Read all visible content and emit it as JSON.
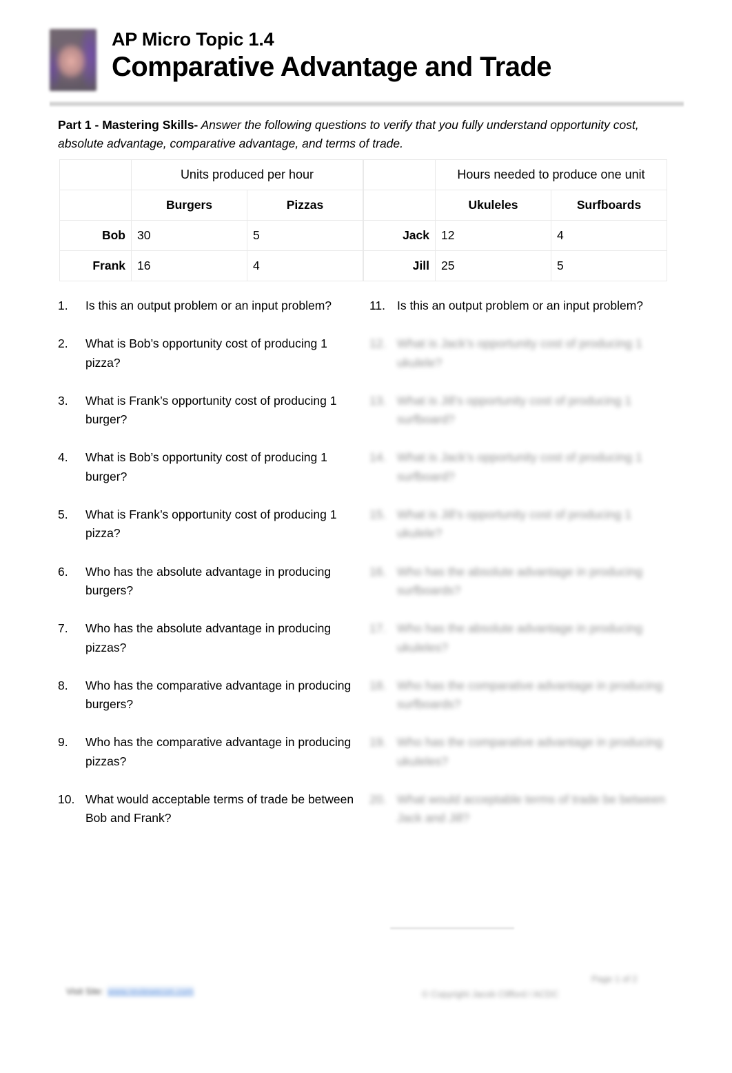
{
  "header": {
    "logo_alt": "course-logo",
    "subtitle": "AP Micro Topic 1.4",
    "title": "Comparative Advantage and Trade"
  },
  "instruction": {
    "label": "Part 1 - Mastering Skills-",
    "text": " Answer the following questions to verify that you fully understand opportunity cost, absolute advantage, comparative advantage, and terms of trade."
  },
  "table_left": {
    "span_header": "Units produced per hour",
    "columns": [
      "Burgers",
      "Pizzas"
    ],
    "rows": [
      {
        "name": "Bob",
        "values": [
          "30",
          "5"
        ]
      },
      {
        "name": "Frank",
        "values": [
          "16",
          "4"
        ]
      }
    ]
  },
  "table_right": {
    "span_header": "Hours needed to produce one unit",
    "columns": [
      "Ukuleles",
      "Surfboards"
    ],
    "rows": [
      {
        "name": "Jack",
        "values": [
          "12",
          "4"
        ]
      },
      {
        "name": "Jill",
        "values": [
          "25",
          "5"
        ]
      }
    ]
  },
  "questions_left": [
    {
      "num": "1.",
      "text": "Is this an output problem or an input problem?",
      "legible": true
    },
    {
      "num": "2.",
      "text": "What is Bob’s opportunity cost of producing 1 pizza?",
      "legible": true
    },
    {
      "num": "3.",
      "text": "What is Frank’s opportunity cost of producing 1 burger?",
      "legible": true
    },
    {
      "num": "4.",
      "text": "What is Bob’s opportunity cost of producing 1 burger?",
      "legible": true
    },
    {
      "num": "5.",
      "text": "What is Frank’s opportunity cost of producing 1 pizza?",
      "legible": true
    },
    {
      "num": "6.",
      "text": "Who has the absolute advantage in producing burgers?",
      "legible": true
    },
    {
      "num": "7.",
      "text": "Who has the absolute advantage in producing pizzas?",
      "legible": true
    },
    {
      "num": "8.",
      "text": "Who has the comparative advantage in producing burgers?",
      "legible": true
    },
    {
      "num": "9.",
      "text": "Who has the comparative advantage in producing pizzas?",
      "legible": true
    },
    {
      "num": "10.",
      "text": "What would acceptable terms of trade be between Bob and Frank?",
      "legible": true
    }
  ],
  "questions_right": [
    {
      "num": "11.",
      "text": "Is this an output problem or an input problem?",
      "legible": true
    },
    {
      "num": "12.",
      "text": "What is Jack’s opportunity cost of producing 1 ukulele?",
      "legible": false
    },
    {
      "num": "13.",
      "text": "What is Jill’s opportunity cost of producing 1 surfboard?",
      "legible": false
    },
    {
      "num": "14.",
      "text": "What is Jack’s opportunity cost of producing 1 surfboard?",
      "legible": false
    },
    {
      "num": "15.",
      "text": "What is Jill’s opportunity cost of producing 1 ukulele?",
      "legible": false
    },
    {
      "num": "16.",
      "text": "Who has the absolute advantage in producing surfboards?",
      "legible": false
    },
    {
      "num": "17.",
      "text": "Who has the absolute advantage in producing ukuleles?",
      "legible": false
    },
    {
      "num": "18.",
      "text": "Who has the comparative advantage in producing surfboards?",
      "legible": false
    },
    {
      "num": "19.",
      "text": "Who has the comparative advantage in producing ukuleles?",
      "legible": false
    },
    {
      "num": "20.",
      "text": "What would acceptable terms of trade be between Jack and Jill?",
      "legible": false
    }
  ],
  "footer": {
    "left_prefix": "Visit Site:",
    "left_link": "www.reviewecon.com",
    "right_top": "Page 1 of 2",
    "right_bottom": "© Copyright Jacob Clifford / ACDC"
  }
}
